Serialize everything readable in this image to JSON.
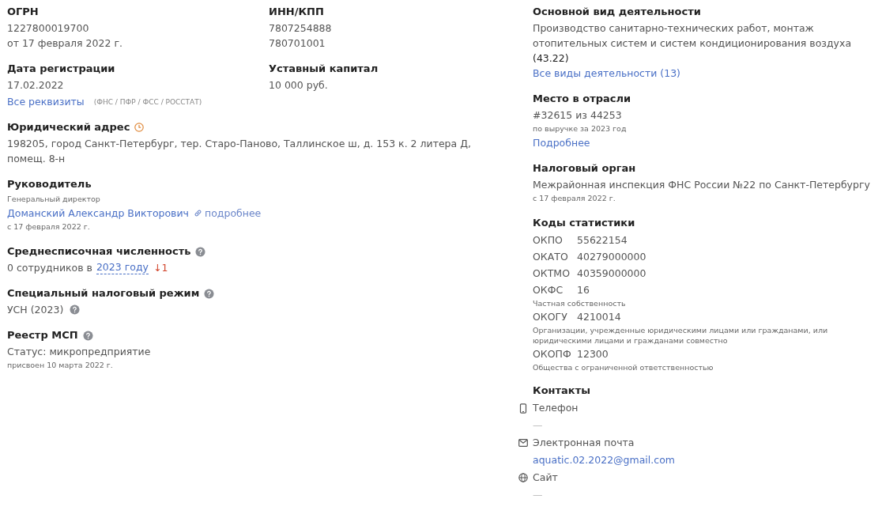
{
  "ogrn": {
    "label": "ОГРН",
    "value": "1227800019700",
    "date": "от 17 февраля 2022 г."
  },
  "inn_kpp": {
    "label": "ИНН/КПП",
    "values": [
      "7807254888",
      "780701001"
    ]
  },
  "registration": {
    "label": "Дата регистрации",
    "value": "17.02.2022"
  },
  "capital": {
    "label": "Уставный капитал",
    "value": "10 000 руб."
  },
  "requisites": {
    "link": "Все реквизиты",
    "sources": "(ФНС / ПФР / ФСС / РОССТАТ)"
  },
  "address": {
    "label": "Юридический адрес",
    "value": "198205, город Санкт-Петербург, тер. Старо-Паново, Таллинское ш, д. 153 к. 2 литера Д, помещ. 8-н"
  },
  "director": {
    "label": "Руководитель",
    "role": "Генеральный директор",
    "name": "Доманский Александр Викторович",
    "more": "подробнее",
    "since": "с 17 февраля 2022 г."
  },
  "headcount": {
    "label": "Среднесписочная численность",
    "prefix": "0 сотрудников в",
    "year_link": "2023 году",
    "change": "↓1"
  },
  "tax_regime": {
    "label": "Специальный налоговый режим",
    "value": "УСН (2023)"
  },
  "msp": {
    "label": "Реестр МСП",
    "status": "Статус: микропредприятие",
    "assigned": "присвоен 10 марта 2022 г."
  },
  "activity": {
    "label": "Основной вид деятельности",
    "description": "Производство санитарно-технических работ, монтаж отопительных систем и систем кондиционирования воздуха",
    "code": "(43.22)",
    "link": "Все виды деятельности (13)"
  },
  "rank": {
    "label": "Место в отрасли",
    "value": "#32615 из 44253",
    "note": "по выручке за 2023 год",
    "link": "Подробнее"
  },
  "tax_office": {
    "label": "Налоговый орган",
    "name": "Межрайонная инспекция ФНС России №22 по Санкт-Петербургу",
    "since": "с 17 февраля 2022 г."
  },
  "stat_codes": {
    "label": "Коды статистики",
    "codes": [
      {
        "code": "ОКПО",
        "value": "55622154"
      },
      {
        "code": "ОКАТО",
        "value": "40279000000"
      },
      {
        "code": "ОКТМО",
        "value": "40359000000"
      },
      {
        "code": "ОКФС",
        "value": "16",
        "note": "Частная собственность"
      },
      {
        "code": "ОКОГУ",
        "value": "4210014",
        "note": "Организации, учрежденные юридическими лицами или гражданами, или юридическими лицами и гражданами совместно"
      },
      {
        "code": "ОКОПФ",
        "value": "12300",
        "note": "Общества с ограниченной ответственностью"
      }
    ]
  },
  "contacts": {
    "label": "Контакты",
    "items": [
      {
        "kind": "phone",
        "label": "Телефон",
        "value": "—"
      },
      {
        "kind": "email",
        "label": "Электронная почта",
        "value": "aquatic.02.2022@gmail.com"
      },
      {
        "kind": "site",
        "label": "Сайт",
        "value": "—"
      }
    ]
  }
}
